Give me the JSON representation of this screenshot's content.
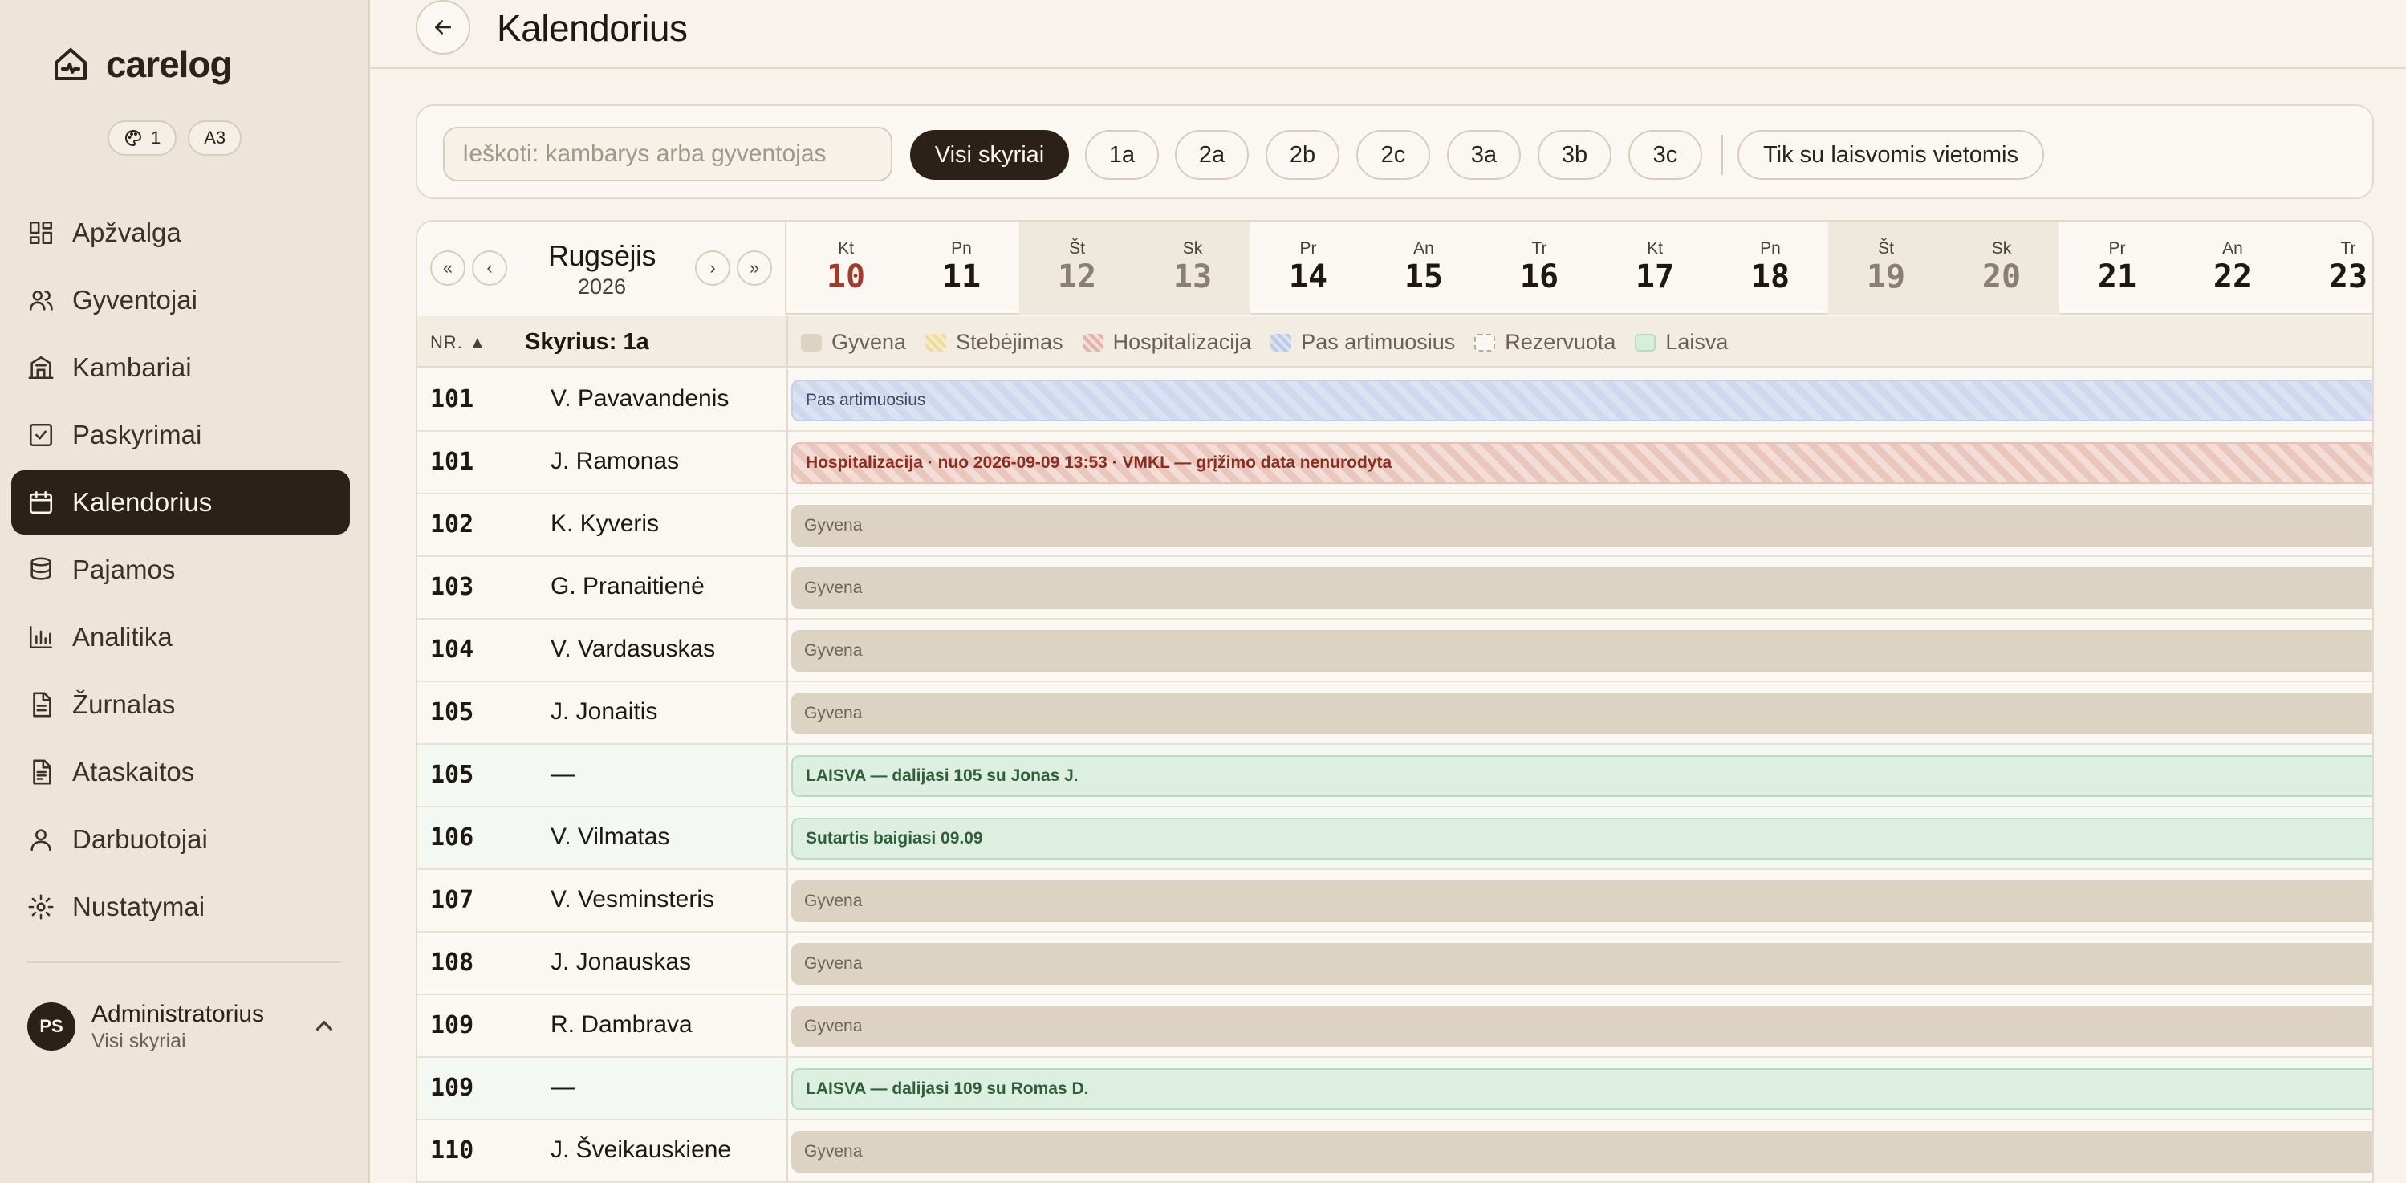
{
  "app": {
    "name": "carelog",
    "badge_count": "1",
    "badge_size": "A3"
  },
  "nav": [
    {
      "label": "Apžvalga",
      "icon": "dashboard-icon"
    },
    {
      "label": "Gyventojai",
      "icon": "users-icon"
    },
    {
      "label": "Kambariai",
      "icon": "building-icon"
    },
    {
      "label": "Paskyrimai",
      "icon": "checkbox-icon"
    },
    {
      "label": "Kalendorius",
      "icon": "calendar-icon",
      "active": true
    },
    {
      "label": "Pajamos",
      "icon": "database-icon"
    },
    {
      "label": "Analitika",
      "icon": "bar-chart-icon"
    },
    {
      "label": "Žurnalas",
      "icon": "document-icon"
    },
    {
      "label": "Ataskaitos",
      "icon": "report-icon"
    },
    {
      "label": "Darbuotojai",
      "icon": "user-icon"
    },
    {
      "label": "Nustatymai",
      "icon": "gear-icon"
    }
  ],
  "user": {
    "initials": "PS",
    "name": "Administratorius",
    "scope": "Visi skyriai"
  },
  "header": {
    "title": "Kalendorius"
  },
  "filters": {
    "search_placeholder": "Ieškoti: kambarys arba gyventojas",
    "chips": [
      "Visi skyriai",
      "1a",
      "2a",
      "2b",
      "2c",
      "3a",
      "3b",
      "3c"
    ],
    "active_chip": "Visi skyriai",
    "free_only": "Tik su laisvomis vietomis"
  },
  "calendar": {
    "month": "Rugsėjis",
    "year": "2026",
    "nav": {
      "first": "«",
      "prev": "‹",
      "next": "›",
      "last": "»"
    },
    "days": [
      {
        "dow": "Kt",
        "day": "10",
        "today": true
      },
      {
        "dow": "Pn",
        "day": "11"
      },
      {
        "dow": "Št",
        "day": "12",
        "weekend": true
      },
      {
        "dow": "Sk",
        "day": "13",
        "weekend": true
      },
      {
        "dow": "Pr",
        "day": "14"
      },
      {
        "dow": "An",
        "day": "15"
      },
      {
        "dow": "Tr",
        "day": "16"
      },
      {
        "dow": "Kt",
        "day": "17"
      },
      {
        "dow": "Pn",
        "day": "18"
      },
      {
        "dow": "Št",
        "day": "19",
        "weekend": true
      },
      {
        "dow": "Sk",
        "day": "20",
        "weekend": true
      },
      {
        "dow": "Pr",
        "day": "21"
      },
      {
        "dow": "An",
        "day": "22"
      },
      {
        "dow": "Tr",
        "day": "23"
      }
    ],
    "nr_header": "NR. ▲",
    "department": "Skyrius: 1a",
    "legend": [
      {
        "label": "Gyvena",
        "color": "#ddd3c3"
      },
      {
        "label": "Stebėjimas",
        "color": "#f6e7b8"
      },
      {
        "label": "Hospitalizacija",
        "color": "#efcfc6"
      },
      {
        "label": "Pas artimuosius",
        "color": "#d3dbef"
      },
      {
        "label": "Rezervuota",
        "color": "#ffffff"
      },
      {
        "label": "Laisva",
        "color": "#d6eedb"
      }
    ],
    "rows": [
      {
        "nr": "101",
        "name": "V. Pavavandenis",
        "status": "artim",
        "bar": "Pas artimuosius"
      },
      {
        "nr": "101",
        "name": "J. Ramonas",
        "status": "hosp",
        "bar": "Hospitalizacija · nuo 2026-09-09 13:53 · VMKL — grįžimo data nenurodyta"
      },
      {
        "nr": "102",
        "name": "K. Kyveris",
        "status": "gyvena",
        "bar": "Gyvena"
      },
      {
        "nr": "103",
        "name": "G. Pranaitienė",
        "status": "gyvena",
        "bar": "Gyvena"
      },
      {
        "nr": "104",
        "name": "V. Vardasuskas",
        "status": "gyvena",
        "bar": "Gyvena"
      },
      {
        "nr": "105",
        "name": "J. Jonaitis",
        "status": "gyvena",
        "bar": "Gyvena"
      },
      {
        "nr": "105",
        "name": "—",
        "status": "laisva",
        "bar": "LAISVA — dalijasi 105 su Jonas J."
      },
      {
        "nr": "106",
        "name": "V. Vilmatas",
        "status": "laisva",
        "bar": "Sutartis baigiasi 09.09"
      },
      {
        "nr": "107",
        "name": "V. Vesminsteris",
        "status": "gyvena",
        "bar": "Gyvena"
      },
      {
        "nr": "108",
        "name": "J. Jonauskas",
        "status": "gyvena",
        "bar": "Gyvena"
      },
      {
        "nr": "109",
        "name": "R. Dambrava",
        "status": "gyvena",
        "bar": "Gyvena"
      },
      {
        "nr": "109",
        "name": "—",
        "status": "laisva",
        "bar": "LAISVA — dalijasi 109 su Romas D."
      },
      {
        "nr": "110",
        "name": "J. Šveikauskiene",
        "status": "gyvena",
        "bar": "Gyvena"
      }
    ]
  }
}
